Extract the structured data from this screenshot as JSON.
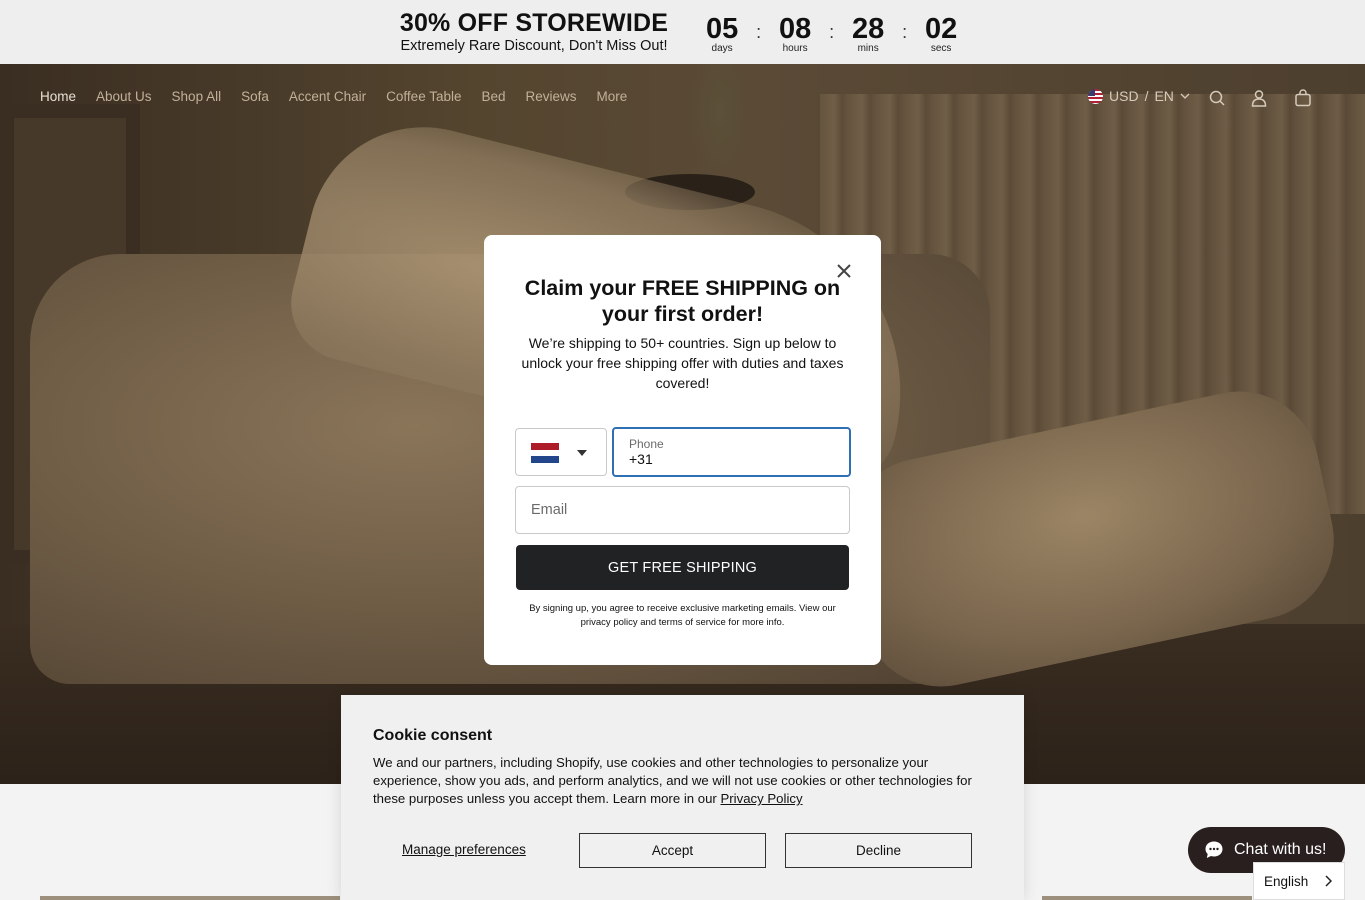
{
  "promo": {
    "title": "30% OFF STOREWIDE",
    "subtitle": "Extremely Rare Discount, Don't Miss Out!",
    "countdown": [
      {
        "value": "05",
        "label": "days"
      },
      {
        "value": "08",
        "label": "hours"
      },
      {
        "value": "28",
        "label": "mins"
      },
      {
        "value": "02",
        "label": "secs"
      }
    ],
    "separator": ":"
  },
  "nav": {
    "items": [
      "Home",
      "About Us",
      "Shop All",
      "Sofa",
      "Accent Chair",
      "Coffee Table",
      "Bed",
      "Reviews",
      "More"
    ],
    "currency": "USD",
    "divider": "/",
    "language": "EN",
    "icons": [
      "search-icon",
      "account-icon",
      "cart-icon"
    ]
  },
  "popup": {
    "title": "Claim your FREE SHIPPING on your first order!",
    "body": "We’re shipping to 50+ countries. Sign up below to unlock your free shipping offer with duties and taxes covered!",
    "country_flag": "Netherlands",
    "phone_label": "Phone",
    "phone_value": "+31",
    "email_placeholder": "Email",
    "submit_label": "GET FREE SHIPPING",
    "disclaimer": "By signing up, you agree to receive exclusive marketing emails. View our privacy policy and terms of service for more info."
  },
  "cookie": {
    "title": "Cookie consent",
    "text": "We and our partners, including Shopify, use cookies and other technologies to personalize your experience, show you ads, and perform analytics, and we will not use cookies or other technologies for these purposes unless you accept them. Learn more in our",
    "policy_link": "Privacy Policy",
    "manage_label": "Manage preferences",
    "accept_label": "Accept",
    "decline_label": "Decline"
  },
  "chat": {
    "label": "Chat with us!"
  },
  "language_selector": {
    "value": "English"
  },
  "colors": {
    "accent_blue": "#2f6fb4",
    "button_dark": "#202223",
    "chat_bg": "#2a1f1f"
  }
}
